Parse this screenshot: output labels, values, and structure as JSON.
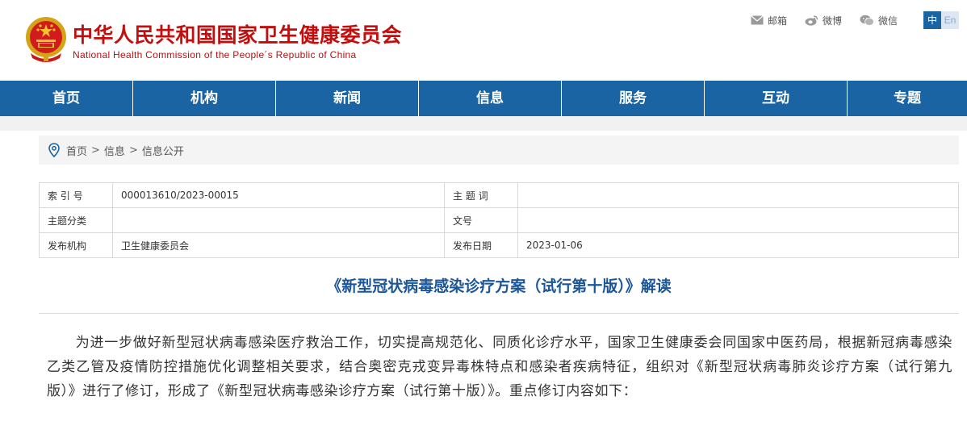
{
  "header": {
    "title_cn": "中华人民共和国国家卫生健康委员会",
    "title_en": "National Health Commission of the People´s Republic of China",
    "emblem_icon": "national-emblem-icon",
    "top_links": [
      {
        "label": "邮箱",
        "icon": "mail-icon"
      },
      {
        "label": "微博",
        "icon": "weibo-icon"
      },
      {
        "label": "微信",
        "icon": "wechat-icon"
      }
    ],
    "lang_cn": "中",
    "lang_en": "En"
  },
  "nav": {
    "items": [
      "首页",
      "机构",
      "新闻",
      "信息",
      "服务",
      "互动",
      "专题"
    ]
  },
  "breadcrumb": {
    "icon": "location-pin-icon",
    "items": [
      "首页",
      "信息",
      "信息公开"
    ],
    "separator": ">"
  },
  "meta": {
    "index_label": "索 引 号",
    "index_value": "000013610/2023-00015",
    "topic_word_label": "主 题 词",
    "topic_word_value": "",
    "category_label": "主题分类",
    "category_value": "",
    "doc_no_label": "文号",
    "doc_no_value": "",
    "publisher_label": "发布机构",
    "publisher_value": "卫生健康委员会",
    "date_label": "发布日期",
    "date_value": "2023-01-06"
  },
  "article": {
    "title": "《新型冠状病毒感染诊疗方案（试行第十版）》解读",
    "body": "为进一步做好新型冠状病毒感染医疗救治工作，切实提高规范化、同质化诊疗水平，国家卫生健康委会同国家中医药局，根据新冠病毒感染乙类乙管及疫情防控措施优化调整相关要求，结合奥密克戎变异毒株特点和感染者疾病特征，组织对《新型冠状病毒肺炎诊疗方案（试行第九版）》进行了修订，形成了《新型冠状病毒感染诊疗方案（试行第十版）》。重点修订内容如下："
  },
  "colors": {
    "brand_red": "#c40d0d",
    "nav_blue": "#1b64a4",
    "title_blue": "#1a5699"
  }
}
